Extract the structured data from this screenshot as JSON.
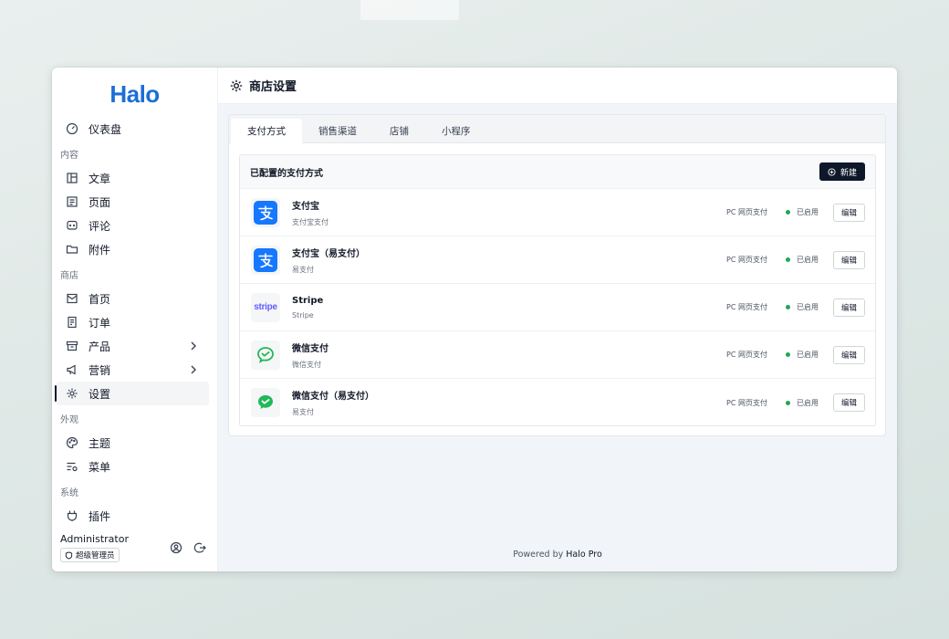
{
  "app": {
    "logo": "Halo"
  },
  "header": {
    "title": "商店设置"
  },
  "sidebar": {
    "dashboard": "仪表盘",
    "groups": {
      "content": "内容",
      "shop": "商店",
      "appearance": "外观",
      "system": "系统"
    },
    "items": {
      "posts": "文章",
      "pages": "页面",
      "comments": "评论",
      "attachments": "附件",
      "home": "首页",
      "orders": "订单",
      "products": "产品",
      "marketing": "营销",
      "settings": "设置",
      "themes": "主题",
      "menus": "菜单",
      "plugins": "插件"
    },
    "user": {
      "name": "Administrator",
      "role": "超级管理员"
    }
  },
  "tabs": [
    "支付方式",
    "销售渠道",
    "店铺",
    "小程序"
  ],
  "payments": {
    "title": "已配置的支付方式",
    "new_label": "新建",
    "rows": [
      {
        "name": "支付宝",
        "sub": "支付宝支付",
        "type": "PC 网页支付",
        "status": "已启用",
        "edit": "编辑",
        "icon": "alipay-icon"
      },
      {
        "name": "支付宝（易支付）",
        "sub": "易支付",
        "type": "PC 网页支付",
        "status": "已启用",
        "edit": "编辑",
        "icon": "alipay-icon"
      },
      {
        "name": "Stripe",
        "sub": "Stripe",
        "type": "PC 网页支付",
        "status": "已启用",
        "edit": "编辑",
        "icon": "stripe-icon"
      },
      {
        "name": "微信支付",
        "sub": "微信支付",
        "type": "PC 网页支付",
        "status": "已启用",
        "edit": "编辑",
        "icon": "wechat-pay-outline-icon"
      },
      {
        "name": "微信支付（易支付）",
        "sub": "易支付",
        "type": "PC 网页支付",
        "status": "已启用",
        "edit": "编辑",
        "icon": "wechat-pay-icon"
      }
    ]
  },
  "footer": {
    "prefix": "Powered by",
    "brand": "Halo Pro"
  },
  "icons": {
    "stripe_text": "stripe"
  },
  "colors": {
    "brand": "#1c6ed8",
    "alipay": "#1677ff",
    "wechat": "#21b857",
    "stripe": "#635bff",
    "enabled": "#22a652"
  }
}
